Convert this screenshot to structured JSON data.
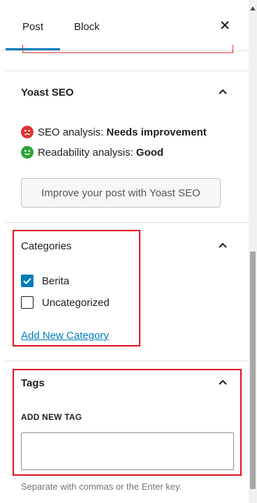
{
  "tabs": {
    "post": "Post",
    "block": "Block"
  },
  "yoast": {
    "title": "Yoast SEO",
    "seo_label": "SEO analysis:",
    "seo_value": "Needs improvement",
    "readability_label": "Readability analysis:",
    "readability_value": "Good",
    "button": "Improve your post with Yoast SEO"
  },
  "categories": {
    "title": "Categories",
    "items": [
      {
        "label": "Berita",
        "checked": true
      },
      {
        "label": "Uncategorized",
        "checked": false
      }
    ],
    "add_new": "Add New Category"
  },
  "tags": {
    "title": "Tags",
    "field_label": "ADD NEW TAG",
    "input_value": "",
    "help": "Separate with commas or the Enter key."
  },
  "colors": {
    "accent": "#007cba",
    "highlight": "#e0101e",
    "seo_bad": "#dc3232",
    "readability_good": "#2fa236"
  }
}
